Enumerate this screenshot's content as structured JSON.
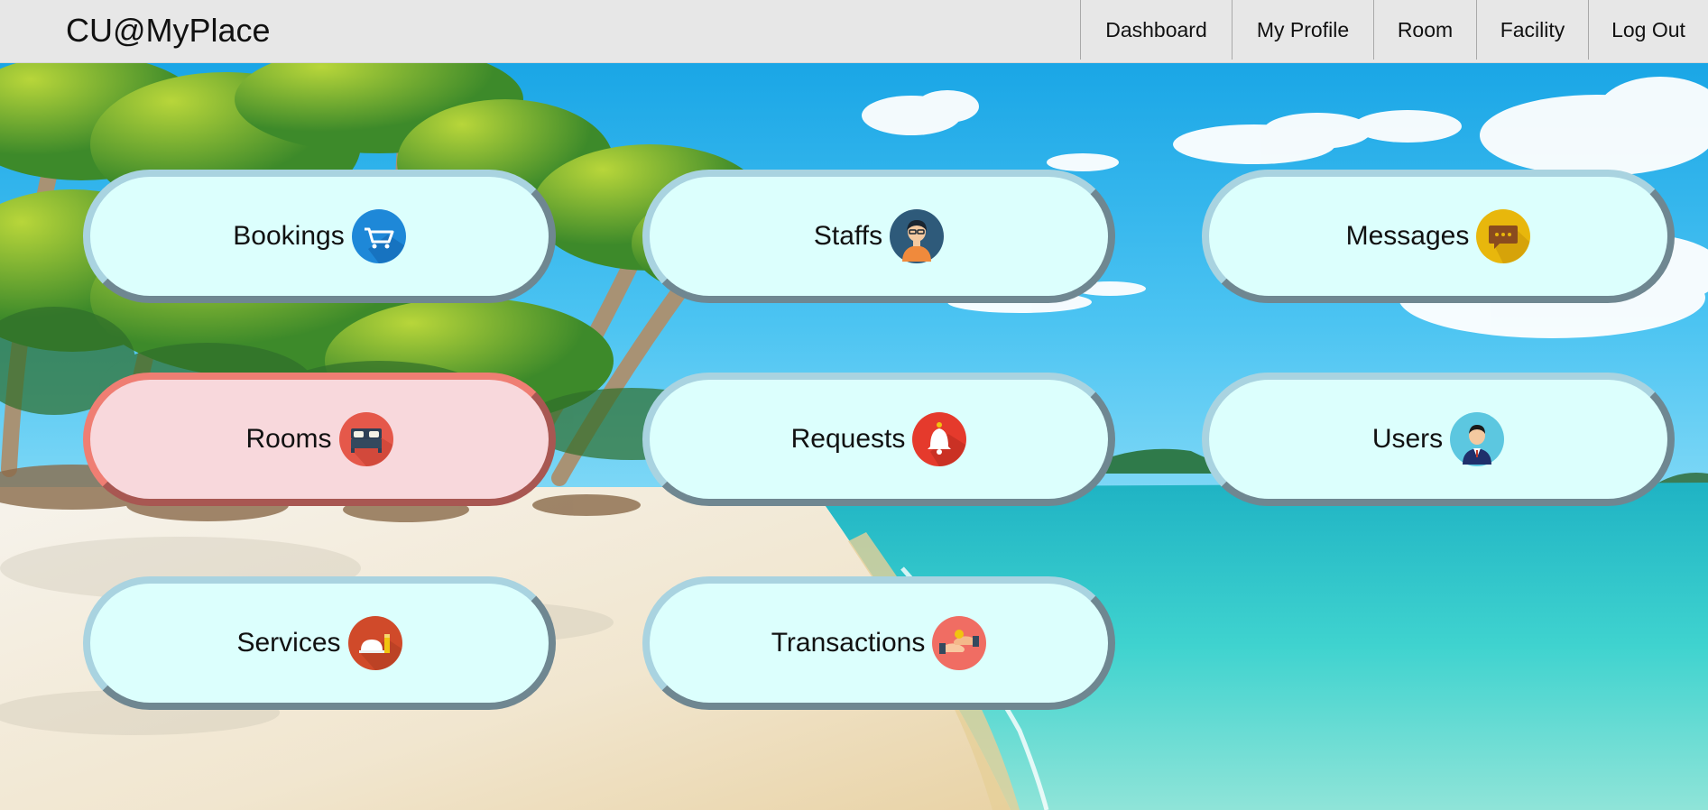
{
  "brand": "CU@MyPlace",
  "nav": {
    "dashboard": "Dashboard",
    "my_profile": "My Profile",
    "room": "Room",
    "facility": "Facility",
    "log_out": "Log Out"
  },
  "tiles": {
    "bookings": {
      "label": "Bookings",
      "icon": "shopping-cart-icon"
    },
    "staffs": {
      "label": "Staffs",
      "icon": "staff-person-icon"
    },
    "messages": {
      "label": "Messages",
      "icon": "chat-bubble-icon"
    },
    "rooms": {
      "label": "Rooms",
      "icon": "bed-icon",
      "active": true
    },
    "requests": {
      "label": "Requests",
      "icon": "bell-icon"
    },
    "users": {
      "label": "Users",
      "icon": "user-icon"
    },
    "services": {
      "label": "Services",
      "icon": "room-service-icon"
    },
    "transactions": {
      "label": "Transactions",
      "icon": "handshake-icon"
    }
  },
  "colors": {
    "navbar_bg": "#e7e7e7",
    "tile_bg": "#dcfffd",
    "tile_active_bg": "#f8d8dc",
    "tile_active_border": "#ef7e73"
  }
}
